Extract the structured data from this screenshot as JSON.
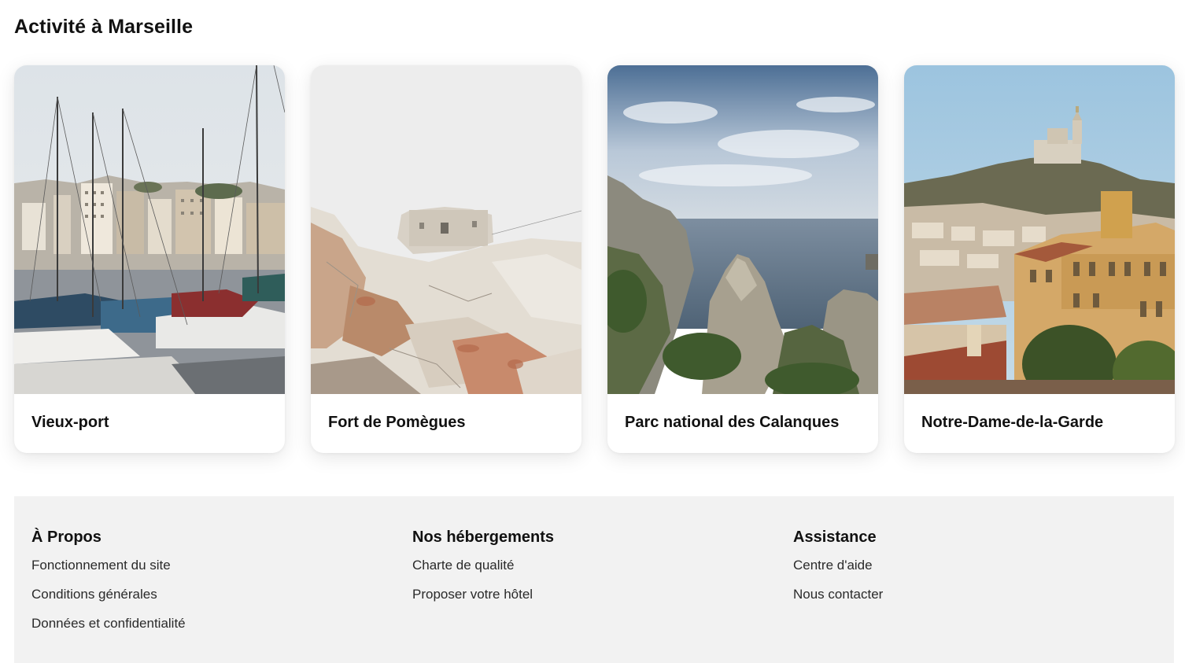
{
  "section": {
    "title": "Activité à Marseille"
  },
  "cards": [
    {
      "label": "Vieux-port",
      "image": "marina-sailboats-photo"
    },
    {
      "label": "Fort de Pomègues",
      "image": "rocky-fort-photo"
    },
    {
      "label": "Parc national des Calanques",
      "image": "calanques-cliffs-sea-photo"
    },
    {
      "label": "Notre-Dame-de-la-Garde",
      "image": "basilica-hill-city-photo"
    }
  ],
  "footer": {
    "columns": [
      {
        "heading": "À Propos",
        "links": [
          "Fonctionnement du site",
          "Conditions générales",
          "Données et confidentialité"
        ]
      },
      {
        "heading": "Nos hébergements",
        "links": [
          "Charte de qualité",
          "Proposer votre hôtel"
        ]
      },
      {
        "heading": "Assistance",
        "links": [
          "Centre d'aide",
          "Nous contacter"
        ]
      }
    ]
  },
  "colors": {
    "text": "#111111",
    "footer_bg": "#f2f2f2",
    "card_bg": "#ffffff"
  }
}
